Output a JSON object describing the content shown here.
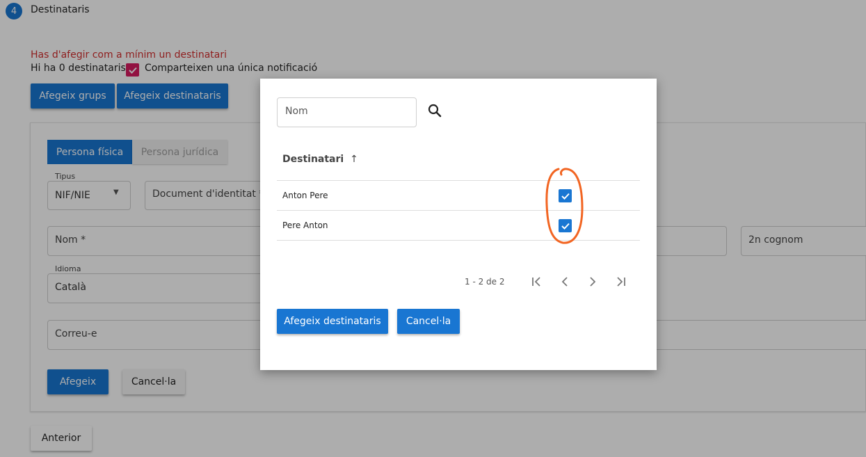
{
  "step": {
    "number": "4",
    "title": "Destinataris"
  },
  "messages": {
    "error": "Has d'afegir com a mínim un destinatari",
    "count": "Hi ha 0 destinataris",
    "share_label": "Comparteixen una única notificació"
  },
  "actions": {
    "add_groups": "Afegeix grups",
    "add_recipients": "Afegeix destinataris"
  },
  "form": {
    "tabs": [
      {
        "label": "Persona física",
        "active": true
      },
      {
        "label": "Persona jurídica",
        "active": false
      }
    ],
    "tipus_label": "Tipus",
    "tipus_value": "NIF/NIE",
    "document_placeholder": "Document d'identitat *",
    "nom_placeholder": "Nom *",
    "cognom2_placeholder": "2n cognom",
    "idioma_label": "Idioma",
    "idioma_value": "Català",
    "email_placeholder": "Correu-e",
    "add_button": "Afegeix",
    "cancel_button": "Cancel·la"
  },
  "nav": {
    "previous": "Anterior"
  },
  "modal": {
    "search_placeholder": "Nom",
    "column_header": "Destinatari",
    "rows": [
      {
        "name": "Anton Pere",
        "checked": true
      },
      {
        "name": "Pere Anton",
        "checked": true
      }
    ],
    "pagination": "1 - 2 de 2",
    "add_button": "Afegeix destinataris",
    "cancel_button": "Cancel·la"
  },
  "colors": {
    "primary": "#1976d2",
    "error": "#d32f2f",
    "share_check": "#d81b60",
    "annotation": "#f26522"
  }
}
